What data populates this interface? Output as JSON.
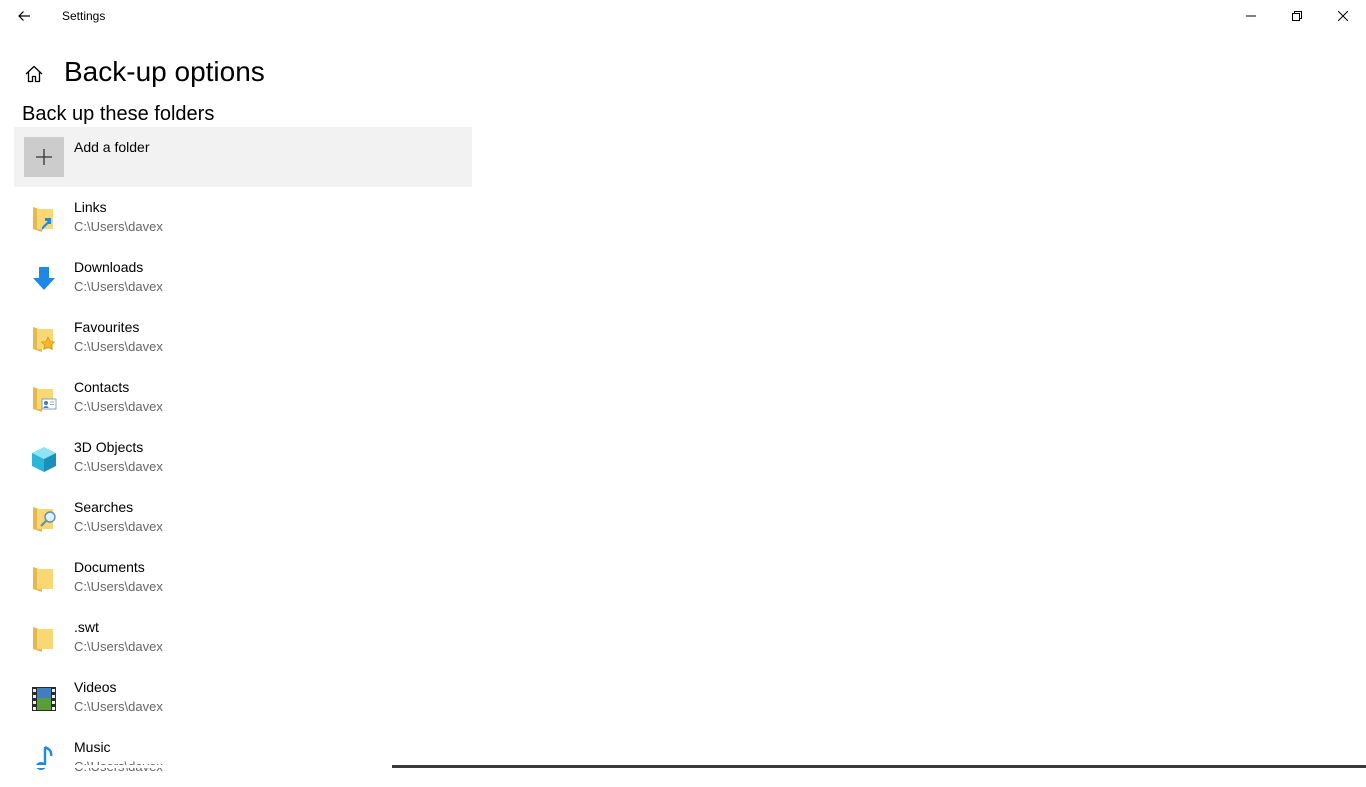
{
  "window": {
    "title": "Settings",
    "back_icon": "back-arrow-icon",
    "minimize_icon": "minimize-icon",
    "restore_icon": "restore-icon",
    "close_icon": "close-icon"
  },
  "page": {
    "home_icon": "home-icon",
    "title": "Back-up options",
    "section_title": "Back up these folders"
  },
  "add_folder": {
    "label": "Add a folder",
    "icon": "plus-icon"
  },
  "folders": [
    {
      "name": "Links",
      "path": "C:\\Users\\davex",
      "icon": "links-folder-icon"
    },
    {
      "name": "Downloads",
      "path": "C:\\Users\\davex",
      "icon": "downloads-icon"
    },
    {
      "name": "Favourites",
      "path": "C:\\Users\\davex",
      "icon": "favourites-folder-icon"
    },
    {
      "name": "Contacts",
      "path": "C:\\Users\\davex",
      "icon": "contacts-folder-icon"
    },
    {
      "name": "3D Objects",
      "path": "C:\\Users\\davex",
      "icon": "3d-objects-icon"
    },
    {
      "name": "Searches",
      "path": "C:\\Users\\davex",
      "icon": "searches-folder-icon"
    },
    {
      "name": "Documents",
      "path": "C:\\Users\\davex",
      "icon": "folder-icon"
    },
    {
      "name": ".swt",
      "path": "C:\\Users\\davex",
      "icon": "folder-icon"
    },
    {
      "name": "Videos",
      "path": "C:\\Users\\davex",
      "icon": "videos-icon"
    },
    {
      "name": "Music",
      "path": "C:\\Users\\davex",
      "icon": "music-icon"
    }
  ],
  "colors": {
    "add_folder_bg": "#f2f2f2",
    "add_box_bg": "#cccccc",
    "folder_yellow": "#f8d775",
    "accent_blue": "#1e88e5"
  }
}
